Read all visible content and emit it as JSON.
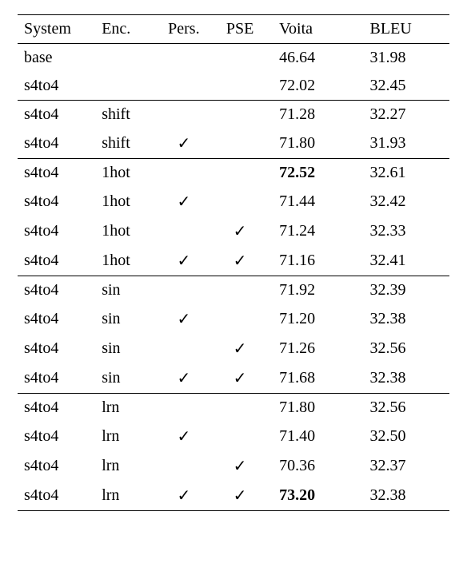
{
  "headers": {
    "system": "System",
    "enc": "Enc.",
    "pers": "Pers.",
    "pse": "PSE",
    "voita": "Voita",
    "bleu": "BLEU"
  },
  "checkmark": "✓",
  "groups": [
    {
      "rows": [
        {
          "system": "base",
          "enc": "",
          "pers": false,
          "pse": false,
          "voita": "46.64",
          "bleu": "31.98",
          "voita_bold": false
        },
        {
          "system": "s4to4",
          "enc": "",
          "pers": false,
          "pse": false,
          "voita": "72.02",
          "bleu": "32.45",
          "voita_bold": false
        }
      ]
    },
    {
      "rows": [
        {
          "system": "s4to4",
          "enc": "shift",
          "pers": false,
          "pse": false,
          "voita": "71.28",
          "bleu": "32.27",
          "voita_bold": false
        },
        {
          "system": "s4to4",
          "enc": "shift",
          "pers": true,
          "pse": false,
          "voita": "71.80",
          "bleu": "31.93",
          "voita_bold": false
        }
      ]
    },
    {
      "rows": [
        {
          "system": "s4to4",
          "enc": "1hot",
          "pers": false,
          "pse": false,
          "voita": "72.52",
          "bleu": "32.61",
          "voita_bold": true
        },
        {
          "system": "s4to4",
          "enc": "1hot",
          "pers": true,
          "pse": false,
          "voita": "71.44",
          "bleu": "32.42",
          "voita_bold": false
        },
        {
          "system": "s4to4",
          "enc": "1hot",
          "pers": false,
          "pse": true,
          "voita": "71.24",
          "bleu": "32.33",
          "voita_bold": false
        },
        {
          "system": "s4to4",
          "enc": "1hot",
          "pers": true,
          "pse": true,
          "voita": "71.16",
          "bleu": "32.41",
          "voita_bold": false
        }
      ]
    },
    {
      "rows": [
        {
          "system": "s4to4",
          "enc": "sin",
          "pers": false,
          "pse": false,
          "voita": "71.92",
          "bleu": "32.39",
          "voita_bold": false
        },
        {
          "system": "s4to4",
          "enc": "sin",
          "pers": true,
          "pse": false,
          "voita": "71.20",
          "bleu": "32.38",
          "voita_bold": false
        },
        {
          "system": "s4to4",
          "enc": "sin",
          "pers": false,
          "pse": true,
          "voita": "71.26",
          "bleu": "32.56",
          "voita_bold": false
        },
        {
          "system": "s4to4",
          "enc": "sin",
          "pers": true,
          "pse": true,
          "voita": "71.68",
          "bleu": "32.38",
          "voita_bold": false
        }
      ]
    },
    {
      "rows": [
        {
          "system": "s4to4",
          "enc": "lrn",
          "pers": false,
          "pse": false,
          "voita": "71.80",
          "bleu": "32.56",
          "voita_bold": false
        },
        {
          "system": "s4to4",
          "enc": "lrn",
          "pers": true,
          "pse": false,
          "voita": "71.40",
          "bleu": "32.50",
          "voita_bold": false
        },
        {
          "system": "s4to4",
          "enc": "lrn",
          "pers": false,
          "pse": true,
          "voita": "70.36",
          "bleu": "32.37",
          "voita_bold": false
        },
        {
          "system": "s4to4",
          "enc": "lrn",
          "pers": true,
          "pse": true,
          "voita": "73.20",
          "bleu": "32.38",
          "voita_bold": true
        }
      ]
    }
  ],
  "chart_data": {
    "type": "table",
    "columns": [
      "System",
      "Enc.",
      "Pers.",
      "PSE",
      "Voita",
      "BLEU"
    ],
    "rows": [
      [
        "base",
        "",
        "",
        "",
        46.64,
        31.98
      ],
      [
        "s4to4",
        "",
        "",
        "",
        72.02,
        32.45
      ],
      [
        "s4to4",
        "shift",
        "",
        "",
        71.28,
        32.27
      ],
      [
        "s4to4",
        "shift",
        "✓",
        "",
        71.8,
        31.93
      ],
      [
        "s4to4",
        "1hot",
        "",
        "",
        72.52,
        32.61
      ],
      [
        "s4to4",
        "1hot",
        "✓",
        "",
        71.44,
        32.42
      ],
      [
        "s4to4",
        "1hot",
        "",
        "✓",
        71.24,
        32.33
      ],
      [
        "s4to4",
        "1hot",
        "✓",
        "✓",
        71.16,
        32.41
      ],
      [
        "s4to4",
        "sin",
        "",
        "",
        71.92,
        32.39
      ],
      [
        "s4to4",
        "sin",
        "✓",
        "",
        71.2,
        32.38
      ],
      [
        "s4to4",
        "sin",
        "",
        "✓",
        71.26,
        32.56
      ],
      [
        "s4to4",
        "sin",
        "✓",
        "✓",
        71.68,
        32.38
      ],
      [
        "s4to4",
        "lrn",
        "",
        "",
        71.8,
        32.56
      ],
      [
        "s4to4",
        "lrn",
        "✓",
        "",
        71.4,
        32.5
      ],
      [
        "s4to4",
        "lrn",
        "",
        "✓",
        70.36,
        32.37
      ],
      [
        "s4to4",
        "lrn",
        "✓",
        "✓",
        73.2,
        32.38
      ]
    ]
  }
}
